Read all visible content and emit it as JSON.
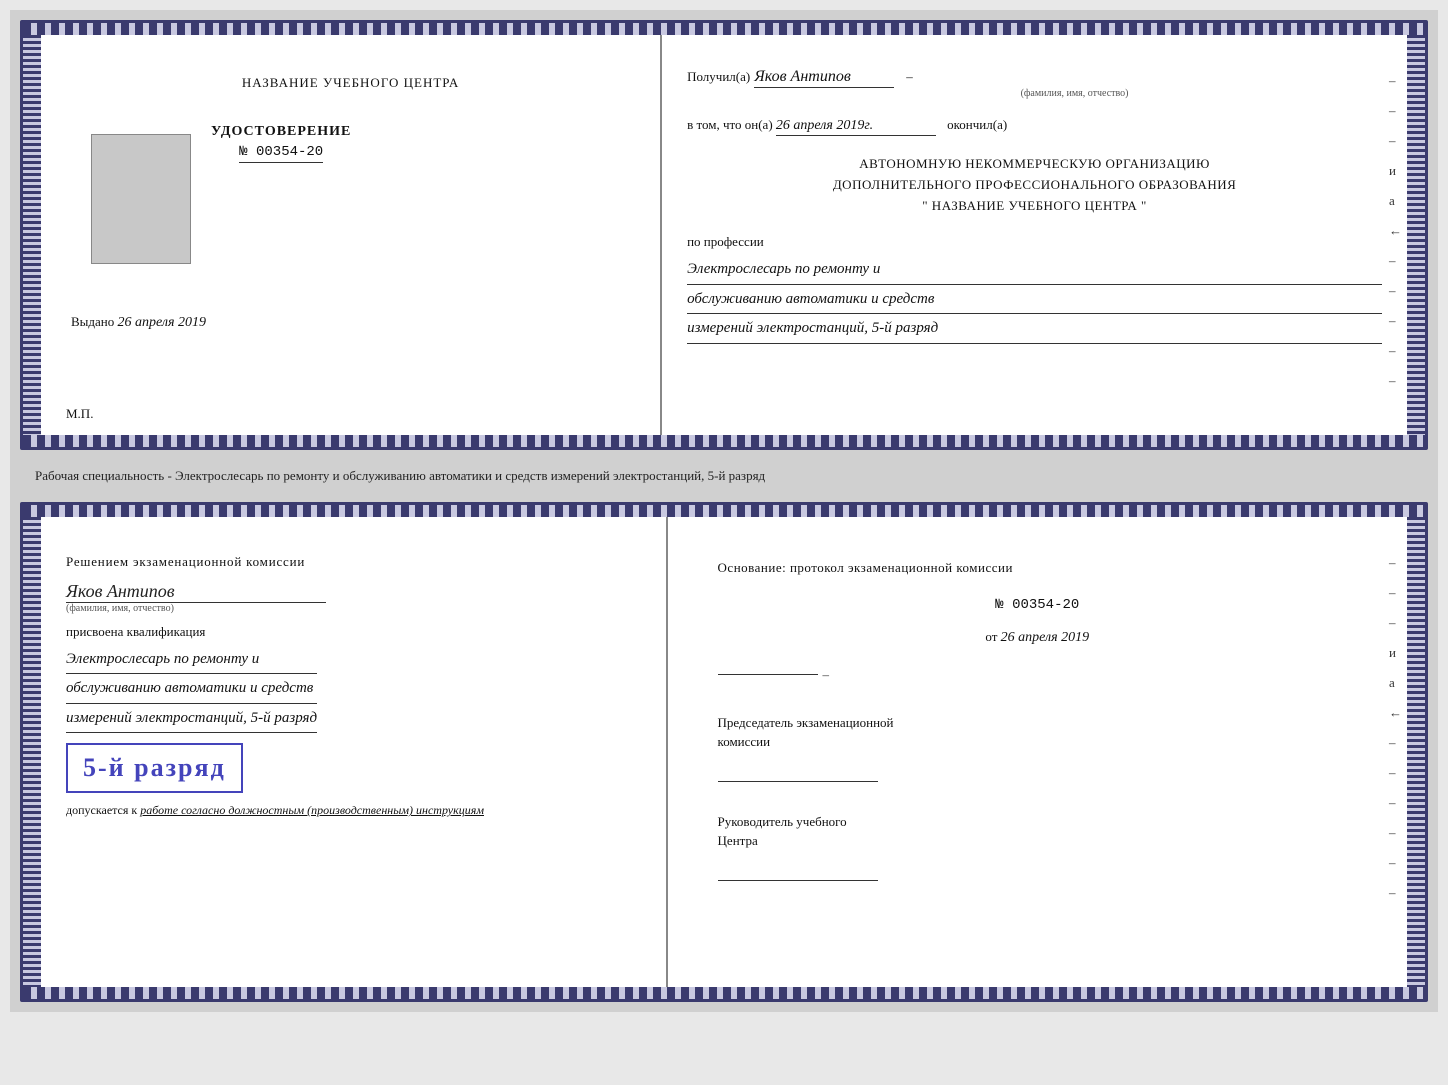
{
  "topBook": {
    "leftPage": {
      "title": "НАЗВАНИЕ УЧЕБНОГО ЦЕНТРА",
      "udostoverenie": "УДОСТОВЕРЕНИЕ",
      "number": "№ 00354-20",
      "vydano": "Выдано",
      "vydano_date": "26 апреля 2019",
      "mp": "М.П."
    },
    "rightPage": {
      "poluchil_label": "Получил(а)",
      "name_handwritten": "Яков Антипов",
      "fio_label": "(фамилия, имя, отчество)",
      "vtom_label": "в том, что он(а)",
      "date_handwritten": "26 апреля 2019г.",
      "okonchil_label": "окончил(а)",
      "avto_line1": "АВТОНОМНУЮ НЕКОММЕРЧЕСКУЮ ОРГАНИЗАЦИЮ",
      "avto_line2": "ДОПОЛНИТЕЛЬНОГО ПРОФЕССИОНАЛЬНОГО ОБРАЗОВАНИЯ",
      "avto_line3": "\"  НАЗВАНИЕ УЧЕБНОГО ЦЕНТРА  \"",
      "po_professii": "по профессии",
      "prof_line1": "Электрослесарь по ремонту и",
      "prof_line2": "обслуживанию автоматики и средств",
      "prof_line3": "измерений электростанций, 5-й разряд"
    }
  },
  "middleText": "Рабочая специальность - Электрослесарь по ремонту и обслуживанию автоматики и средств измерений электростанций, 5-й разряд",
  "bottomBook": {
    "leftPage": {
      "resheniem": "Решением экзаменационной комиссии",
      "name_handwritten": "Яков Антипов",
      "fio_label": "(фамилия, имя, отчество)",
      "prisvoena": "присвоена квалификация",
      "qual_line1": "Электрослесарь по ремонту и",
      "qual_line2": "обслуживанию автоматики и средств",
      "qual_line3": "измерений электростанций, 5-й разряд",
      "razryad_badge": "5-й разряд",
      "dopuskaetsya": "допускается к",
      "dopuskaetsya_rest": "работе согласно должностным (производственным) инструкциям"
    },
    "rightPage": {
      "osnovanie": "Основание: протокол экзаменационной комиссии",
      "protocol_number": "№ 00354-20",
      "ot_label": "от",
      "ot_date": "26 апреля 2019",
      "chairman_line1": "Председатель экзаменационной",
      "chairman_line2": "комиссии",
      "rukovoditel_line1": "Руководитель учебного",
      "rukovoditel_line2": "Центра"
    }
  }
}
